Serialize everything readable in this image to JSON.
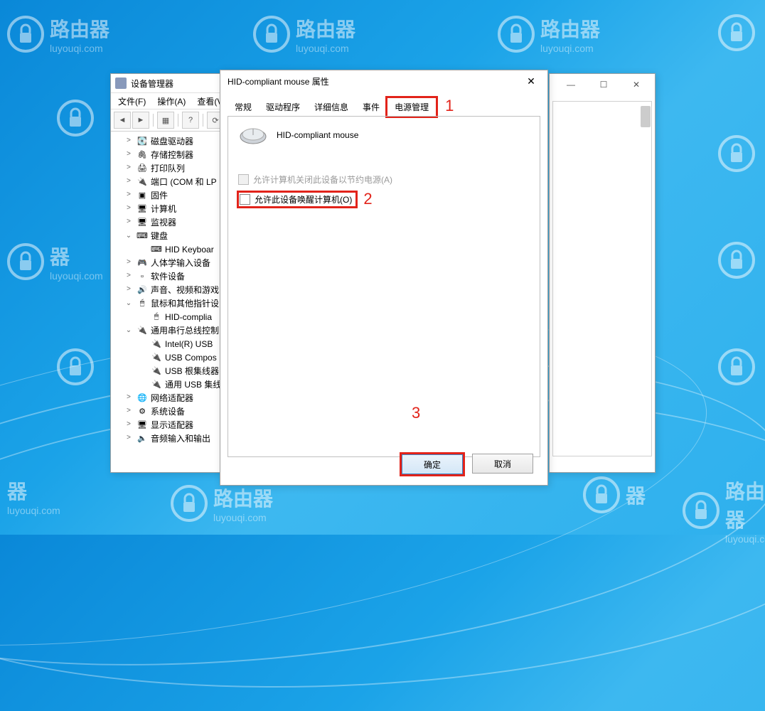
{
  "watermark": {
    "title": "路由器",
    "sub": "luyouqi.com"
  },
  "device_manager": {
    "title": "设备管理器",
    "menu": {
      "file": "文件(F)",
      "action": "操作(A)",
      "view": "查看(V"
    },
    "tree": [
      {
        "indent": 1,
        "exp": ">",
        "icon": "disk",
        "label": "磁盘驱动器"
      },
      {
        "indent": 1,
        "exp": ">",
        "icon": "storage",
        "label": "存储控制器"
      },
      {
        "indent": 1,
        "exp": ">",
        "icon": "printer",
        "label": "打印队列"
      },
      {
        "indent": 1,
        "exp": ">",
        "icon": "port",
        "label": "端口 (COM 和 LP"
      },
      {
        "indent": 1,
        "exp": ">",
        "icon": "firmware",
        "label": "固件"
      },
      {
        "indent": 1,
        "exp": ">",
        "icon": "computer",
        "label": "计算机"
      },
      {
        "indent": 1,
        "exp": ">",
        "icon": "monitor",
        "label": "监视器"
      },
      {
        "indent": 1,
        "exp": "v",
        "icon": "keyboard",
        "label": "键盘"
      },
      {
        "indent": 2,
        "exp": "",
        "icon": "keyboard",
        "label": "HID Keyboar"
      },
      {
        "indent": 1,
        "exp": ">",
        "icon": "hid",
        "label": "人体学输入设备"
      },
      {
        "indent": 1,
        "exp": ">",
        "icon": "software",
        "label": "软件设备"
      },
      {
        "indent": 1,
        "exp": ">",
        "icon": "audio",
        "label": "声音、视频和游戏"
      },
      {
        "indent": 1,
        "exp": "v",
        "icon": "mouse",
        "label": "鼠标和其他指针设"
      },
      {
        "indent": 2,
        "exp": "",
        "icon": "mouse",
        "label": "HID-complia"
      },
      {
        "indent": 1,
        "exp": "v",
        "icon": "usb-hub",
        "label": "通用串行总线控制"
      },
      {
        "indent": 2,
        "exp": "",
        "icon": "usb",
        "label": "Intel(R) USB "
      },
      {
        "indent": 2,
        "exp": "",
        "icon": "usb",
        "label": "USB Compos"
      },
      {
        "indent": 2,
        "exp": "",
        "icon": "usb",
        "label": "USB 根集线器"
      },
      {
        "indent": 2,
        "exp": "",
        "icon": "usb",
        "label": "通用 USB 集线"
      },
      {
        "indent": 1,
        "exp": ">",
        "icon": "network",
        "label": "网络适配器"
      },
      {
        "indent": 1,
        "exp": ">",
        "icon": "system",
        "label": "系统设备"
      },
      {
        "indent": 1,
        "exp": ">",
        "icon": "display",
        "label": "显示适配器"
      },
      {
        "indent": 1,
        "exp": ">",
        "icon": "audio-io",
        "label": "音频输入和输出"
      }
    ]
  },
  "properties_dialog": {
    "title": "HID-compliant mouse 属性",
    "tabs": {
      "general": "常规",
      "driver": "驱动程序",
      "details": "详细信息",
      "events": "事件",
      "power": "电源管理"
    },
    "device_name": "HID-compliant mouse",
    "checkbox_off": "允许计算机关闭此设备以节约电源(A)",
    "checkbox_wake": "允许此设备唤醒计算机(O)",
    "buttons": {
      "ok": "确定",
      "cancel": "取消"
    },
    "annotations": {
      "a1": "1",
      "a2": "2",
      "a3": "3"
    }
  }
}
